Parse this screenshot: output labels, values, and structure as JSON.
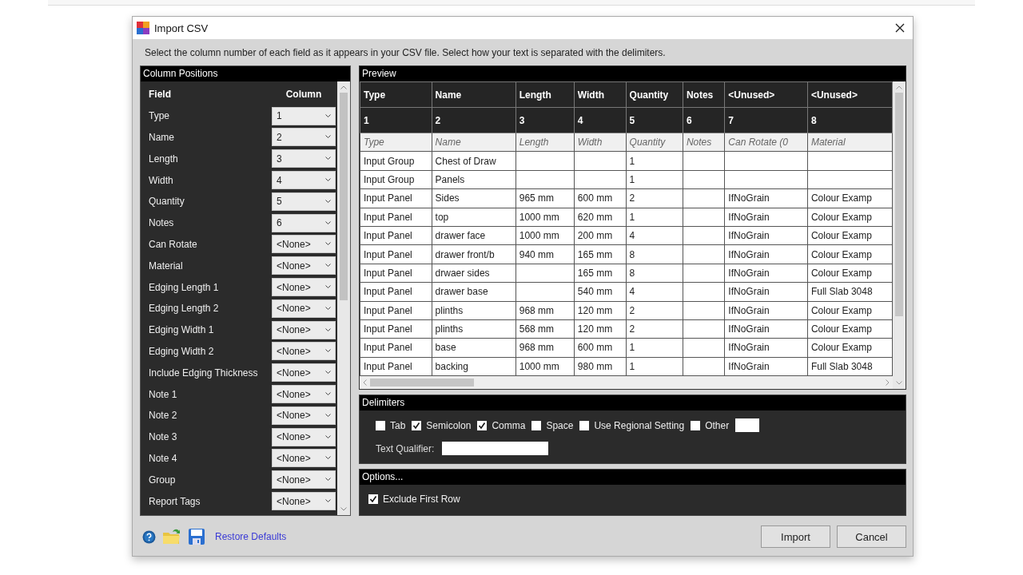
{
  "window": {
    "title": "Import CSV"
  },
  "instructions": "Select the column number of each field as it appears in your CSV file. Select how your text is separated with the delimiters.",
  "column_positions": {
    "title": "Column Positions",
    "headers": [
      "Field",
      "Column"
    ],
    "fields": [
      {
        "field": "Type",
        "column": "1"
      },
      {
        "field": "Name",
        "column": "2"
      },
      {
        "field": "Length",
        "column": "3"
      },
      {
        "field": "Width",
        "column": "4"
      },
      {
        "field": "Quantity",
        "column": "5"
      },
      {
        "field": "Notes",
        "column": "6"
      },
      {
        "field": "Can Rotate",
        "column": "<None>"
      },
      {
        "field": "Material",
        "column": "<None>"
      },
      {
        "field": "Edging Length 1",
        "column": "<None>"
      },
      {
        "field": "Edging Length 2",
        "column": "<None>"
      },
      {
        "field": "Edging Width 1",
        "column": "<None>"
      },
      {
        "field": "Edging Width 2",
        "column": "<None>"
      },
      {
        "field": "Include Edging Thickness",
        "column": "<None>"
      },
      {
        "field": "Note 1",
        "column": "<None>"
      },
      {
        "field": "Note 2",
        "column": "<None>"
      },
      {
        "field": "Note 3",
        "column": "<None>"
      },
      {
        "field": "Note 4",
        "column": "<None>"
      },
      {
        "field": "Group",
        "column": "<None>"
      },
      {
        "field": "Report Tags",
        "column": "<None>"
      }
    ]
  },
  "preview": {
    "title": "Preview",
    "columns": [
      {
        "field": "Type",
        "number": "1"
      },
      {
        "field": "Name",
        "number": "2"
      },
      {
        "field": "Length",
        "number": "3"
      },
      {
        "field": "Width",
        "number": "4"
      },
      {
        "field": "Quantity",
        "number": "5"
      },
      {
        "field": "Notes",
        "number": "6"
      },
      {
        "field": "<Unused>",
        "number": "7"
      },
      {
        "field": "<Unused>",
        "number": "8"
      }
    ],
    "rows": [
      {
        "excluded": true,
        "cells": [
          "Type",
          "Name",
          "Length",
          "Width",
          "Quantity",
          "Notes",
          "Can Rotate (0",
          "Material"
        ]
      },
      {
        "excluded": false,
        "cells": [
          "Input Group",
          "Chest of Draw",
          null,
          null,
          "1",
          null,
          null,
          null
        ]
      },
      {
        "excluded": false,
        "cells": [
          "Input Group",
          "Panels",
          null,
          null,
          "1",
          null,
          null,
          null
        ]
      },
      {
        "excluded": false,
        "cells": [
          "Input Panel",
          "Sides",
          "965 mm",
          "600 mm",
          "2",
          null,
          "IfNoGrain",
          "Colour Examp"
        ]
      },
      {
        "excluded": false,
        "cells": [
          "Input Panel",
          "top",
          "1000 mm",
          "620 mm",
          "1",
          null,
          "IfNoGrain",
          "Colour Examp"
        ]
      },
      {
        "excluded": false,
        "cells": [
          "Input Panel",
          "drawer face",
          "1000 mm",
          "200 mm",
          "4",
          null,
          "IfNoGrain",
          "Colour Examp"
        ]
      },
      {
        "excluded": false,
        "cells": [
          "Input Panel",
          "drawer front/b",
          "940 mm",
          "165 mm",
          "8",
          null,
          "IfNoGrain",
          "Colour Examp"
        ]
      },
      {
        "excluded": false,
        "cells": [
          "Input Panel",
          "drwaer sides",
          null,
          "165 mm",
          "8",
          null,
          "IfNoGrain",
          "Colour Examp"
        ]
      },
      {
        "excluded": false,
        "cells": [
          "Input Panel",
          "drawer base",
          null,
          "540 mm",
          "4",
          null,
          "IfNoGrain",
          "Full Slab 3048"
        ]
      },
      {
        "excluded": false,
        "cells": [
          "Input Panel",
          "plinths",
          "968 mm",
          "120 mm",
          "2",
          null,
          "IfNoGrain",
          "Colour Examp"
        ]
      },
      {
        "excluded": false,
        "cells": [
          "Input Panel",
          "plinths",
          "568 mm",
          "120 mm",
          "2",
          null,
          "IfNoGrain",
          "Colour Examp"
        ]
      },
      {
        "excluded": false,
        "cells": [
          "Input Panel",
          "base",
          "968 mm",
          "600 mm",
          "1",
          null,
          "IfNoGrain",
          "Colour Examp"
        ]
      },
      {
        "excluded": false,
        "cells": [
          "Input Panel",
          "backing",
          "1000 mm",
          "980 mm",
          "1",
          null,
          "IfNoGrain",
          "Full Slab 3048"
        ]
      }
    ]
  },
  "delimiters": {
    "title": "Delimiters",
    "options": [
      {
        "label": "Tab",
        "checked": false
      },
      {
        "label": "Semicolon",
        "checked": true
      },
      {
        "label": "Comma",
        "checked": true
      },
      {
        "label": "Space",
        "checked": false
      },
      {
        "label": "Use Regional Setting",
        "checked": false
      },
      {
        "label": "Other",
        "checked": false
      }
    ],
    "text_qualifier_label": "Text Qualifier:"
  },
  "options": {
    "title": "Options...",
    "items": [
      {
        "label": "Exclude First Row",
        "checked": true
      }
    ]
  },
  "footer": {
    "link": "Restore Defaults",
    "buttons": [
      "Import",
      "Cancel"
    ]
  }
}
